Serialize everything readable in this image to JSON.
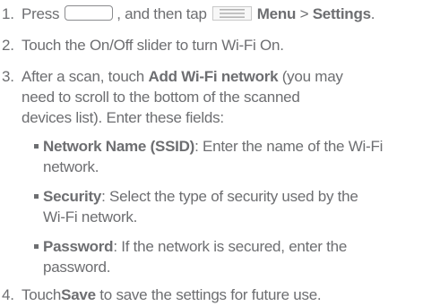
{
  "steps": [
    {
      "num": "1.",
      "pre": "Press",
      "mid": ", and then tap",
      "menu": "Menu",
      "sep": " > ",
      "settings": "Settings",
      "end": "."
    },
    {
      "num": "2.",
      "text": "Touch the On/Off slider to turn Wi-Fi On."
    },
    {
      "num": "3.",
      "pre": "After a scan, touch ",
      "bold": "Add Wi-Fi network",
      "post": " (you may",
      "line2": "need to scroll to the bottom of the scanned",
      "line3": "devices list). Enter these fields:"
    },
    {
      "num": "4.",
      "pre": "Touch",
      "bold": "Save",
      "post": " to save the settings for future use."
    }
  ],
  "bullets": [
    {
      "label": "Network Name (SSID)",
      "text": ": Enter the name of the Wi-Fi",
      "line2": "network."
    },
    {
      "label": "Security",
      "text": ": Select the type of security used by the",
      "line2": "Wi-Fi network."
    },
    {
      "label": "Password",
      "text": ": If the network is secured, enter the",
      "line2": "password."
    }
  ],
  "icons": {
    "home": "home-button-icon",
    "menu": "menu-icon"
  }
}
